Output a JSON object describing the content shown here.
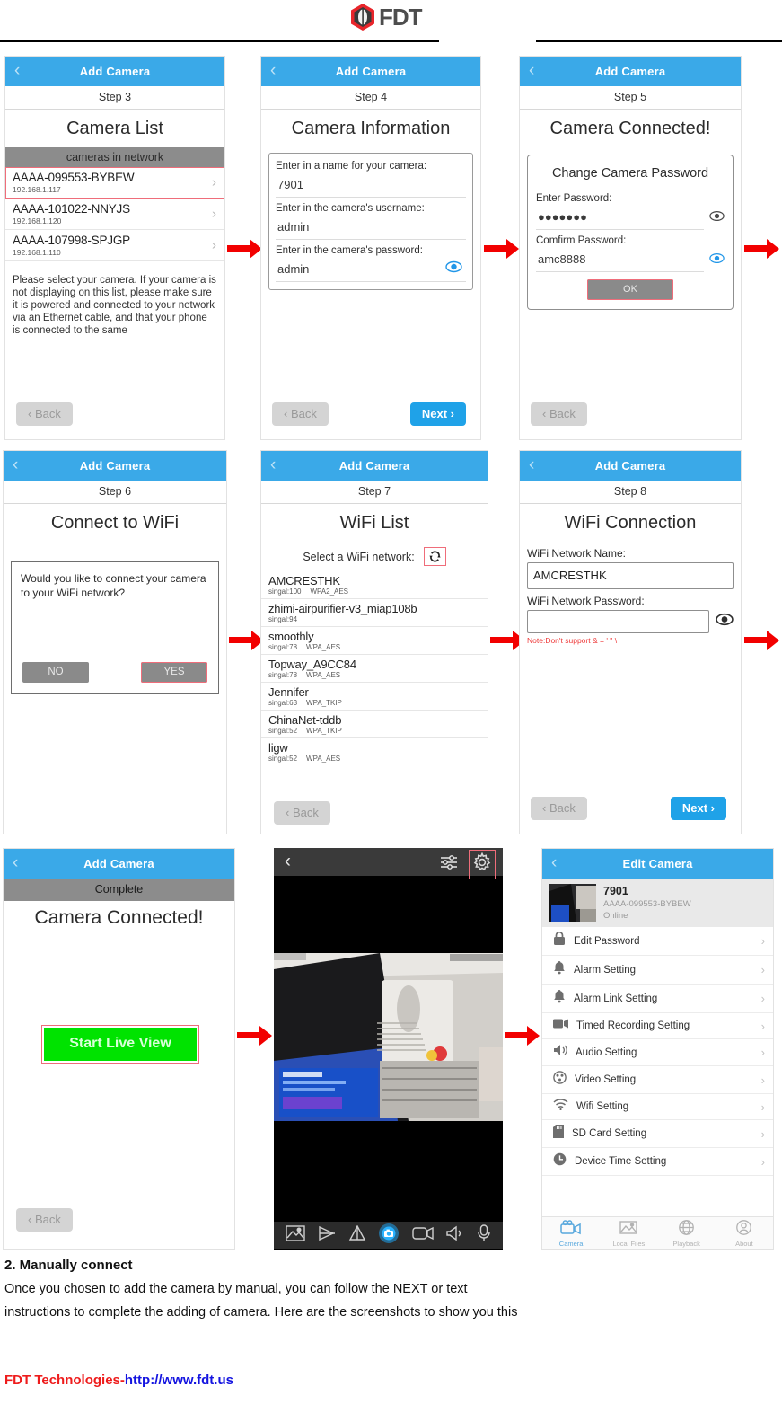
{
  "header": {
    "brand": "FDT",
    "logo_icon": "fdt-hexagon-logo"
  },
  "panels": {
    "step3": {
      "navbar_title": "Add Camera",
      "step_label": "Step 3",
      "page_title": "Camera List",
      "list_header": "cameras in network",
      "cameras": [
        {
          "name": "AAAA-099553-BYBEW",
          "ip": "192.168.1.117",
          "highlighted": true
        },
        {
          "name": "AAAA-101022-NNYJS",
          "ip": "192.168.1.120",
          "highlighted": false
        },
        {
          "name": "AAAA-107998-SPJGP",
          "ip": "192.168.1.110",
          "highlighted": false
        }
      ],
      "help_text": "Please select your camera. If your camera is not displaying on this list, please make sure it is powered and connected to your network via an Ethernet cable, and that your phone is connected to the same",
      "back_label": "Back"
    },
    "step4": {
      "navbar_title": "Add Camera",
      "step_label": "Step 4",
      "page_title": "Camera Information",
      "name_label": "Enter in a name for your camera:",
      "name_value": "7901",
      "user_label": "Enter in the camera's username:",
      "user_value": "admin",
      "pass_label": "Enter in the camera's password:",
      "pass_value": "admin",
      "back_label": "Back",
      "next_label": "Next"
    },
    "step5": {
      "navbar_title": "Add Camera",
      "step_label": "Step 5",
      "page_title": "Camera Connected!",
      "modal_title": "Change Camera Password",
      "enter_label": "Enter Password:",
      "enter_value": "●●●●●●●",
      "confirm_label": "Comfirm Password:",
      "confirm_value": "amc8888",
      "ok_label": "OK",
      "back_label": "Back"
    },
    "step6": {
      "navbar_title": "Add Camera",
      "step_label": "Step 6",
      "page_title": "Connect to WiFi",
      "question": "Would you like to connect your camera to your WiFi network?",
      "no_label": "NO",
      "yes_label": "YES"
    },
    "step7": {
      "navbar_title": "Add Camera",
      "step_label": "Step 7",
      "page_title": "WiFi List",
      "select_label": "Select a WiFi network:",
      "refresh_icon": "refresh-icon",
      "networks": [
        {
          "ssid": "AMCRESTHK",
          "signal": "singal:100",
          "security": "WPA2_AES"
        },
        {
          "ssid": "zhimi-airpurifier-v3_miap108b",
          "signal": "singal:94",
          "security": ""
        },
        {
          "ssid": "smoothly",
          "signal": "singal:78",
          "security": "WPA_AES"
        },
        {
          "ssid": "Topway_A9CC84",
          "signal": "singal:78",
          "security": "WPA_AES"
        },
        {
          "ssid": "Jennifer",
          "signal": "singal:63",
          "security": "WPA_TKIP"
        },
        {
          "ssid": "ChinaNet-tddb",
          "signal": "singal:52",
          "security": "WPA_TKIP"
        },
        {
          "ssid": "ligw",
          "signal": "singal:52",
          "security": "WPA_AES"
        }
      ],
      "back_label": "Back"
    },
    "step8": {
      "navbar_title": "Add Camera",
      "step_label": "Step 8",
      "page_title": "WiFi Connection",
      "ssid_label": "WiFi Network Name:",
      "ssid_value": "AMCRESTHK",
      "pass_label": "WiFi Network Password:",
      "pass_value": "",
      "note": "Note:Don't support & = ' \" \\",
      "back_label": "Back",
      "next_label": "Next"
    },
    "complete": {
      "navbar_title": "Add Camera",
      "step_label": "Complete",
      "page_title": "Camera Connected!",
      "live_label": "Start Live View",
      "back_label": "Back"
    },
    "liveview": {
      "back_icon": "chevron-left-icon",
      "sliders_icon": "sliders-icon",
      "gear_icon": "gear-icon",
      "toolbar_icons": [
        "snapshot-icon",
        "flip-horizontal-icon",
        "mirror-icon",
        "capture-icon",
        "record-icon",
        "speaker-icon",
        "microphone-icon"
      ]
    },
    "editcamera": {
      "navbar_title": "Edit Camera",
      "device_name": "7901",
      "device_uid": "AAAA-099553-BYBEW",
      "device_status": "Online",
      "settings": [
        {
          "label": "Edit Password",
          "icon": "lock-icon"
        },
        {
          "label": "Alarm Setting",
          "icon": "bell-icon"
        },
        {
          "label": "Alarm Link Setting",
          "icon": "bell-icon"
        },
        {
          "label": "Timed Recording Setting",
          "icon": "video-camera-icon"
        },
        {
          "label": "Audio Setting",
          "icon": "speaker-icon"
        },
        {
          "label": "Video Setting",
          "icon": "video-settings-icon"
        },
        {
          "label": "Wifi Setting",
          "icon": "wifi-icon"
        },
        {
          "label": "SD Card Setting",
          "icon": "sd-card-icon"
        },
        {
          "label": "Device Time Setting",
          "icon": "clock-icon"
        }
      ],
      "tabs": [
        {
          "label": "Camera",
          "icon": "camera-tab-icon",
          "active": true
        },
        {
          "label": "Local Files",
          "icon": "photo-tab-icon",
          "active": false
        },
        {
          "label": "Playback",
          "icon": "globe-tab-icon",
          "active": false
        },
        {
          "label": "About",
          "icon": "person-tab-icon",
          "active": false
        }
      ]
    }
  },
  "body": {
    "heading": "2. Manually connect",
    "paragraph_line1": "Once you chosen to add the camera by manual, you can follow the NEXT or text",
    "paragraph_line2": "instructions to complete the adding of camera. Here are the screenshots to show you this"
  },
  "footer": {
    "company": "FDT Technologies-",
    "url": "http://www.fdt.us"
  },
  "colors": {
    "accent_blue": "#3aa9e8",
    "highlight_red": "#ef6d7a",
    "arrow_red": "#f20000",
    "green": "#00e300",
    "footer_red": "#ee1c1c",
    "footer_blue": "#1414e0"
  }
}
